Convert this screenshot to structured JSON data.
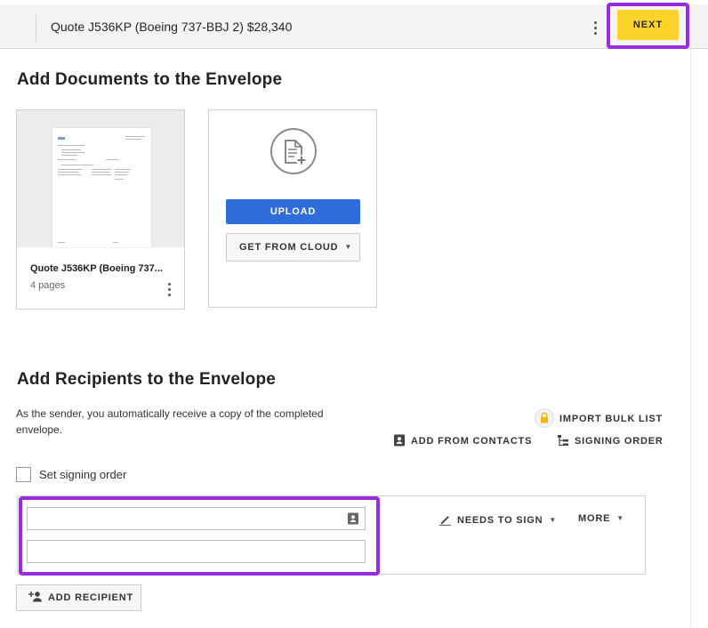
{
  "topbar": {
    "title": "Quote J536KP (Boeing 737-BBJ 2) $28,340",
    "next_label": "NEXT"
  },
  "documents": {
    "heading": "Add Documents to the Envelope",
    "items": [
      {
        "name": "Quote J536KP (Boeing 737...",
        "pages": "4 pages"
      }
    ],
    "upload_label": "UPLOAD",
    "cloud_label": "GET FROM CLOUD"
  },
  "recipients": {
    "heading": "Add Recipients to the Envelope",
    "sender_note": "As the sender, you automatically receive a copy of the completed envelope.",
    "import_bulk": "IMPORT BULK LIST",
    "add_contacts": "ADD FROM CONTACTS",
    "signing_order": "SIGNING ORDER",
    "set_order_label": "Set signing order",
    "set_order_checked": false,
    "recipient": {
      "name_value": "",
      "email_value": "",
      "action": "NEEDS TO SIGN",
      "more": "MORE"
    },
    "add_recipient": "ADD RECIPIENT"
  },
  "colors": {
    "accent_yellow": "#fcd32b",
    "primary_blue": "#2e6ddb",
    "highlight_purple": "#9a2be0"
  },
  "icons": [
    "kebab-icon",
    "document-add-icon",
    "lock-icon",
    "contacts-icon",
    "signing-order-icon",
    "pen-icon",
    "caret-down-icon",
    "add-person-icon"
  ]
}
